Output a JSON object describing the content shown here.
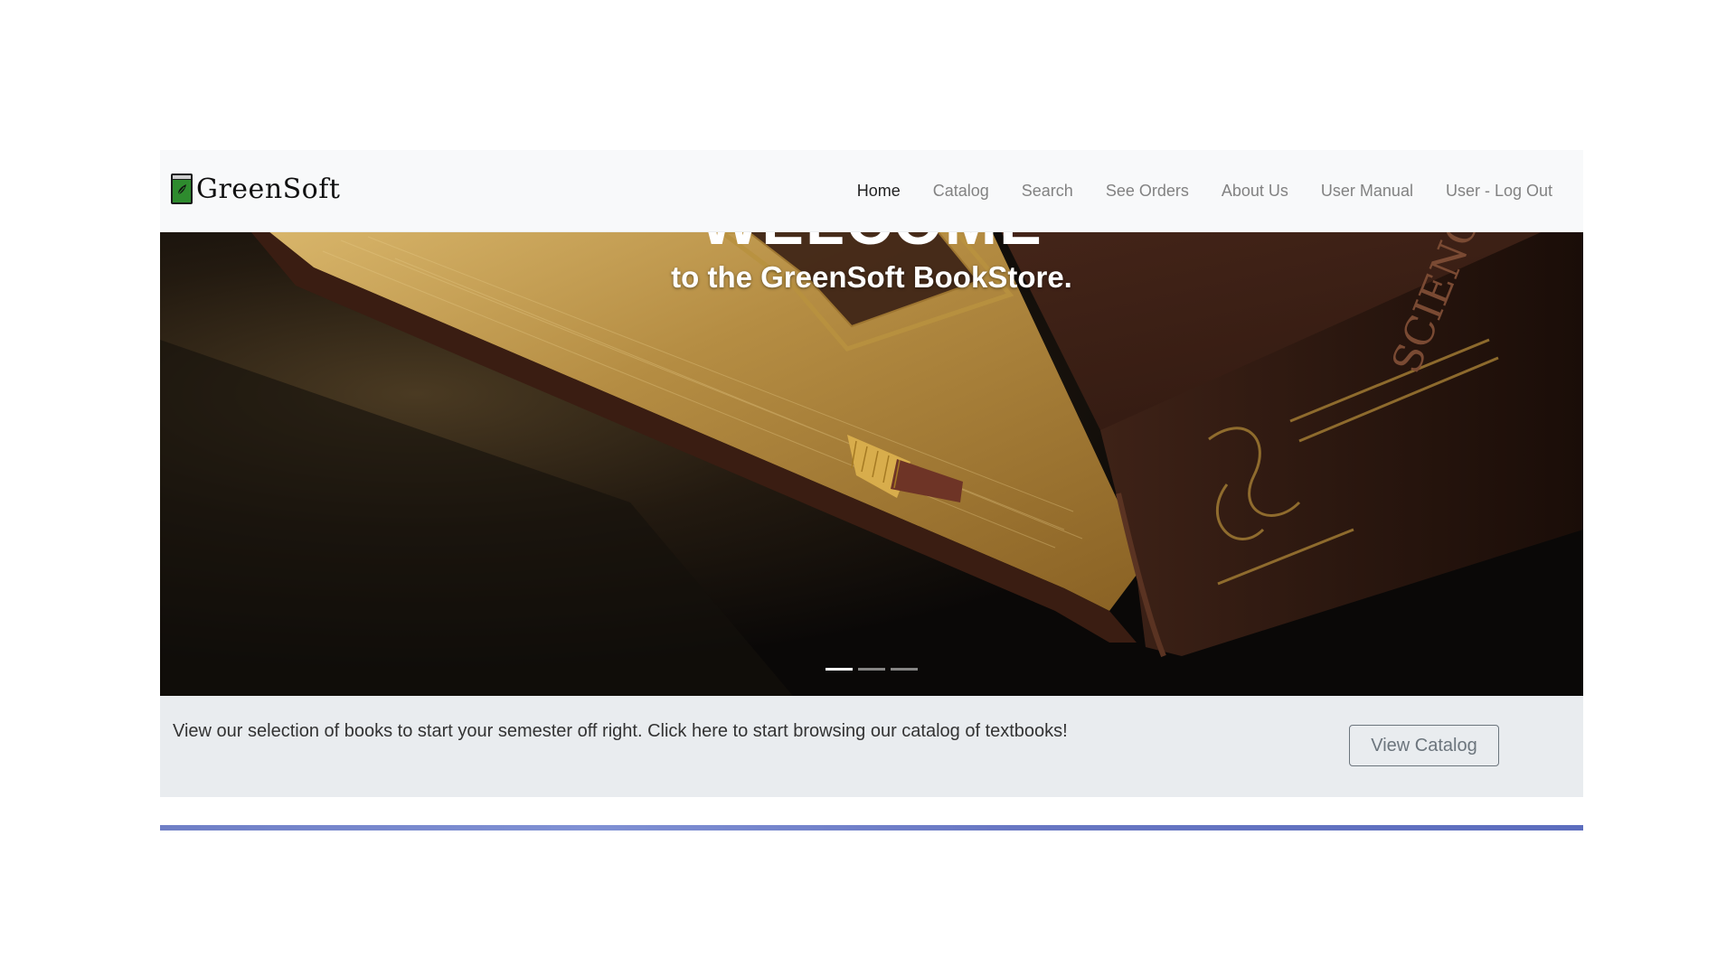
{
  "brand": {
    "name": "GreenSoft",
    "icon": "book-icon",
    "icon_color": "#2e8b2e"
  },
  "nav": {
    "items": [
      {
        "label": "Home",
        "active": true
      },
      {
        "label": "Catalog",
        "active": false
      },
      {
        "label": "Search",
        "active": false
      },
      {
        "label": "See Orders",
        "active": false
      },
      {
        "label": "About Us",
        "active": false
      },
      {
        "label": "User Manual",
        "active": false
      },
      {
        "label": "User - Log Out",
        "active": false
      }
    ]
  },
  "hero": {
    "title": "WELCOME",
    "subtitle": "to the GreenSoft BookStore.",
    "slides": 3,
    "active_slide": 1
  },
  "promo": {
    "text": "View our selection of books to start your semester off right. Click here to start browsing our catalog of textbooks!",
    "button_label": "View Catalog"
  },
  "colors": {
    "navbar_bg": "#f8f9fa",
    "promo_bg": "#e9ecef",
    "accent_strip": "#6f7fc6"
  }
}
